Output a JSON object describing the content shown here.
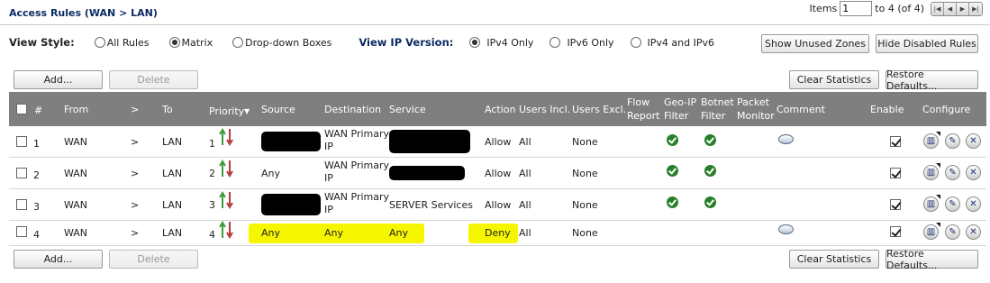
{
  "header": {
    "title": "Access Rules (WAN > LAN)",
    "items_label": "Items",
    "items_value": "1",
    "range_text": "to 4 (of 4)"
  },
  "view": {
    "style_label": "View Style:",
    "opt_all": "All Rules",
    "opt_matrix": "Matrix",
    "opt_dropdown": "Drop-down Boxes",
    "ip_label": "View IP Version:",
    "opt_ipv4": "IPv4 Only",
    "opt_ipv6": "IPv6 Only",
    "opt_both": "IPv4 and IPv6",
    "show_unused": "Show Unused Zones",
    "hide_disabled": "Hide Disabled Rules"
  },
  "toolbar": {
    "add": "Add...",
    "delete": "Delete",
    "clear": "Clear Statistics",
    "restore": "Restore Defaults..."
  },
  "table": {
    "columns": {
      "num": "#",
      "from": "From",
      "arrow": ">",
      "to": "To",
      "priority": "Priority",
      "source": "Source",
      "destination": "Destination",
      "service": "Service",
      "action": "Action",
      "users_incl": "Users Incl.",
      "users_excl": "Users Excl.",
      "flow_report_1": "Flow",
      "flow_report_2": "Report",
      "geoip_1": "Geo-IP",
      "geoip_2": "Filter",
      "botnet_1": "Botnet",
      "botnet_2": "Filter",
      "packet_1": "Packet",
      "packet_2": "Monitor",
      "comment": "Comment",
      "enable": "Enable",
      "configure": "Configure"
    },
    "rows": [
      {
        "num": "1",
        "from": "WAN",
        "arrow": ">",
        "to": "LAN",
        "priority": "1",
        "source": "",
        "dest_1": "WAN Primary",
        "dest_2": "IP",
        "service": "",
        "action": "Allow",
        "users_incl": "All",
        "users_excl": "None"
      },
      {
        "num": "2",
        "from": "WAN",
        "arrow": ">",
        "to": "LAN",
        "priority": "2",
        "source": "Any",
        "dest_1": "WAN Primary",
        "dest_2": "IP",
        "service": "",
        "action": "Allow",
        "users_incl": "All",
        "users_excl": "None"
      },
      {
        "num": "3",
        "from": "WAN",
        "arrow": ">",
        "to": "LAN",
        "priority": "3",
        "source": "",
        "dest_1": "WAN Primary",
        "dest_2": "IP",
        "service": "SERVER Services",
        "action": "Allow",
        "users_incl": "All",
        "users_excl": "None"
      },
      {
        "num": "4",
        "from": "WAN",
        "arrow": ">",
        "to": "LAN",
        "priority": "4",
        "source": "Any",
        "dest_1": "Any",
        "dest_2": "",
        "service": "Any",
        "action": "Deny",
        "users_incl": "All",
        "users_excl": "None"
      }
    ]
  },
  "colors": {
    "header_bg": "#7f7f7f",
    "allow": "#1b8f1b",
    "deny": "#d01515",
    "highlight": "#f6f600",
    "title": "#0c2b64"
  }
}
